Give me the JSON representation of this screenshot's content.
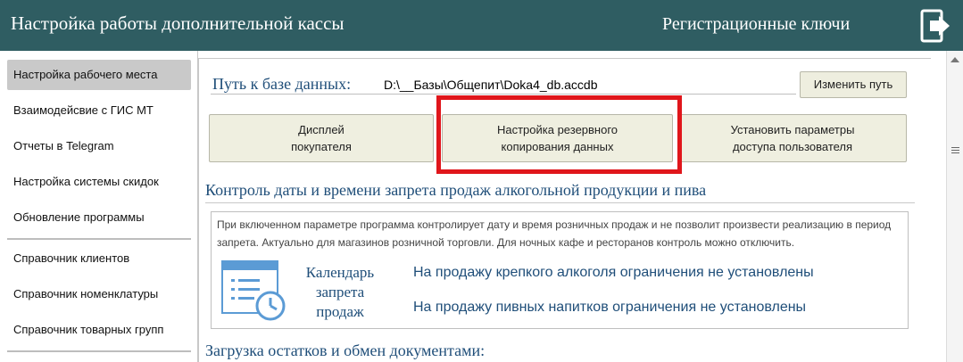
{
  "header": {
    "title": "Настройка работы дополнительной кассы",
    "keys_link": "Регистрационные ключи",
    "exit_icon": "exit-door-icon"
  },
  "sidebar": {
    "items": [
      {
        "label": "Настройка рабочего места",
        "active": true
      },
      {
        "label": "Взаимодейсвие с ГИС МТ"
      },
      {
        "label": "Отчеты в Telegram"
      },
      {
        "label": "Настройка системы скидок"
      },
      {
        "label": "Обновление программы"
      },
      {
        "label": "Справочник клиентов"
      },
      {
        "label": "Справочник номенклатуры"
      },
      {
        "label": "Справочник товарных групп"
      }
    ]
  },
  "db_path": {
    "label": "Путь к базе данных:",
    "value": "D:\\__Базы\\Общепит\\Doka4_db.accdb",
    "change_button": "Изменить путь"
  },
  "buttons": {
    "display": [
      "Дисплей",
      "покупателя"
    ],
    "backup": [
      "Настройка резервного",
      "копирования данных"
    ],
    "access": [
      "Установить параметры",
      "доступа пользователя"
    ]
  },
  "alcohol_section": {
    "title": "Контроль даты и времени запрета продаж алкогольной продукции и пива",
    "description": "При включенном параметре программа контролирует дату и время розничных продаж и не позволит произвести реализацию в период запрета. Актуально для магазинов розничной торговли. Для ночных кафе и ресторанов контроль можно отключить.",
    "calendar_label": [
      "Календарь",
      "запрета",
      "продаж"
    ],
    "strong_status": "На продажу крепкого алкоголя ограничения не установлены",
    "beer_status": "На продажу пивных напитков ограничения не установлены"
  },
  "stock_section": {
    "title": "Загрузка остатков и обмен документами:"
  },
  "colors": {
    "header_bg": "#2f5d62",
    "accent_text": "#1f4e79",
    "highlight_frame": "#e0161b",
    "button_bg": "#efefe0"
  }
}
